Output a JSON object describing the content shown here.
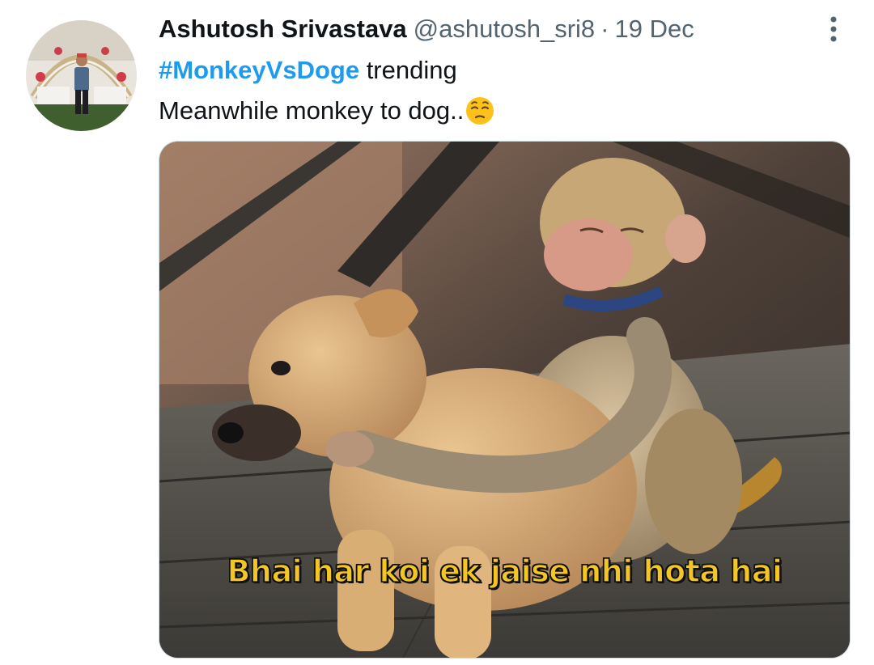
{
  "tweet": {
    "author": {
      "display_name": "Ashutosh Srivastava",
      "handle": "@ashutosh_sri8"
    },
    "separator": "·",
    "date": "19 Dec",
    "text": {
      "hashtag": "#MonkeyVsDoge",
      "line1_rest": " trending",
      "line2": "Meanwhile monkey to dog.."
    },
    "emoji": "pensive-face",
    "media": {
      "caption": "Bhai har koi ek jaise nhi hota hai"
    },
    "icons": {
      "more": "more-vertical-icon"
    },
    "colors": {
      "hashtag": "#1d9bf0",
      "secondary_text": "#536471",
      "caption_fill": "#f3c623"
    }
  }
}
